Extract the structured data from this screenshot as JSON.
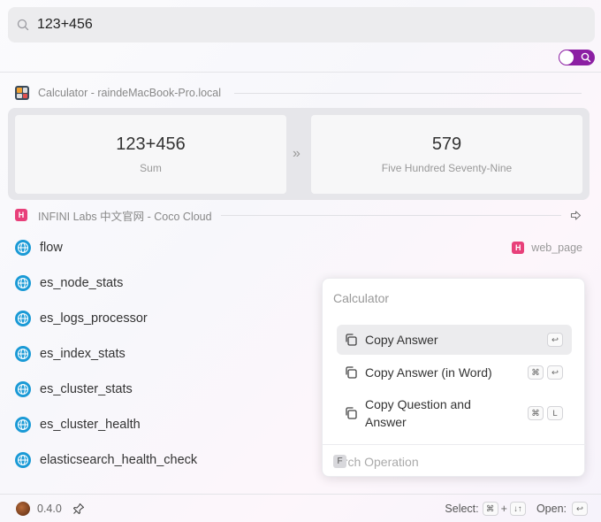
{
  "search": {
    "query": "123+456"
  },
  "toggle": {
    "state": "on",
    "color": "#8c1fa3"
  },
  "calculator_section": {
    "header": "Calculator - raindeMacBook-Pro.local",
    "question": "123+456",
    "question_sub": "Sum",
    "answer": "579",
    "answer_sub": "Five Hundred Seventy-Nine",
    "arrow": "»"
  },
  "coco_section": {
    "header": "INFINI Labs 中文官网 - Coco Cloud",
    "badge": "H",
    "results": [
      {
        "title": "flow",
        "meta": "web_page"
      },
      {
        "title": "es_node_stats"
      },
      {
        "title": "es_logs_processor"
      },
      {
        "title": "es_index_stats"
      },
      {
        "title": "es_cluster_stats"
      },
      {
        "title": "es_cluster_health"
      },
      {
        "title": "elasticsearch_health_check"
      }
    ]
  },
  "popup": {
    "heading": "Calculator",
    "items": [
      {
        "label": "Copy Answer",
        "keys": [
          "↩"
        ]
      },
      {
        "label": "Copy Answer (in Word)",
        "keys": [
          "⌘",
          "↩"
        ]
      },
      {
        "label": "Copy Question and Answer",
        "keys": [
          "⌘",
          "L"
        ]
      }
    ],
    "search_badge": "F",
    "search_placeholder": "arch Operation"
  },
  "footer": {
    "version": "0.4.0",
    "select_label": "Select:",
    "select_key1": "⌘",
    "select_plus": "+",
    "select_key2": "↓↑",
    "open_label": "Open:",
    "open_key": "↩"
  }
}
